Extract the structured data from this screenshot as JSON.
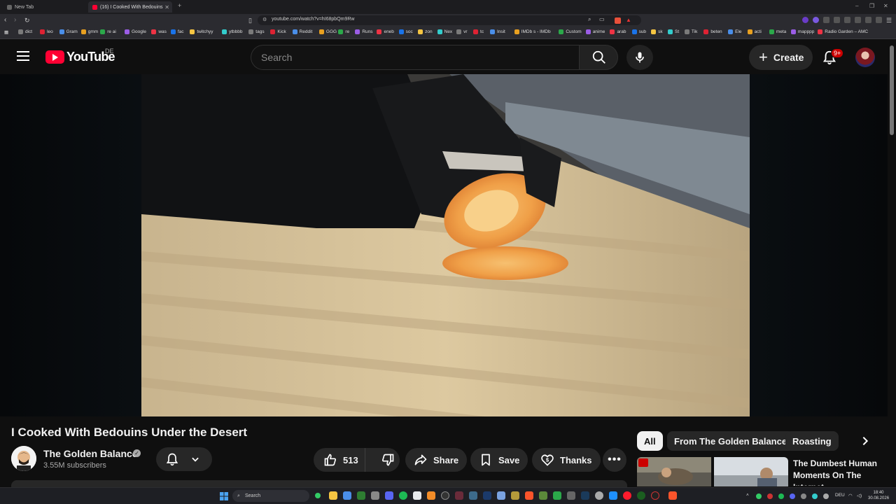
{
  "browser": {
    "tabs": [
      {
        "title": "New Tab",
        "active": false
      },
      {
        "title": "(16) I Cooked With Bedouins",
        "active": true
      }
    ],
    "new_tab_symbol": "+",
    "url": "youtube.com/watch?v=hI68pbQm9Rw",
    "bookmarks": [
      "dict",
      "leo",
      "Gram",
      "gmm",
      "re ai",
      "Google",
      "was",
      "fac",
      "twitchyy",
      "ytbbbb",
      "tags",
      "Kick",
      "Reddit",
      "GGG",
      "re",
      "Runs",
      "eneb",
      "soc",
      "zon",
      "Nex",
      "vr",
      "tc",
      "Insit",
      "IMDb s - IMDb",
      "Custom",
      "anime",
      "arab",
      "sub",
      "sk",
      "St",
      "Tik",
      "beten",
      "Ele",
      "acti",
      "meta",
      "mapppp",
      "Radio Garden – AMC"
    ]
  },
  "header": {
    "logo_text": "YouTube",
    "region": "DE",
    "search_placeholder": "Search",
    "create_label": "Create",
    "notification_count": "9+"
  },
  "video": {
    "title": "I Cooked With Bedouins Under the Desert",
    "channel": "The Golden Balance",
    "subscribers": "3.55M subscribers",
    "likes": "513",
    "share_label": "Share",
    "save_label": "Save",
    "thanks_label": "Thanks"
  },
  "chips": [
    "All",
    "From The Golden Balance",
    "Roasting"
  ],
  "recommendation": {
    "title": "The Dumbest Human Moments On The Internet"
  },
  "taskbar": {
    "search_label": "Search",
    "language": "DEU",
    "time": "18:40",
    "date": "30.08.2026"
  },
  "colors": {
    "youtube_red": "#ff0033",
    "background": "#0f0f0f",
    "pill": "#272727"
  }
}
